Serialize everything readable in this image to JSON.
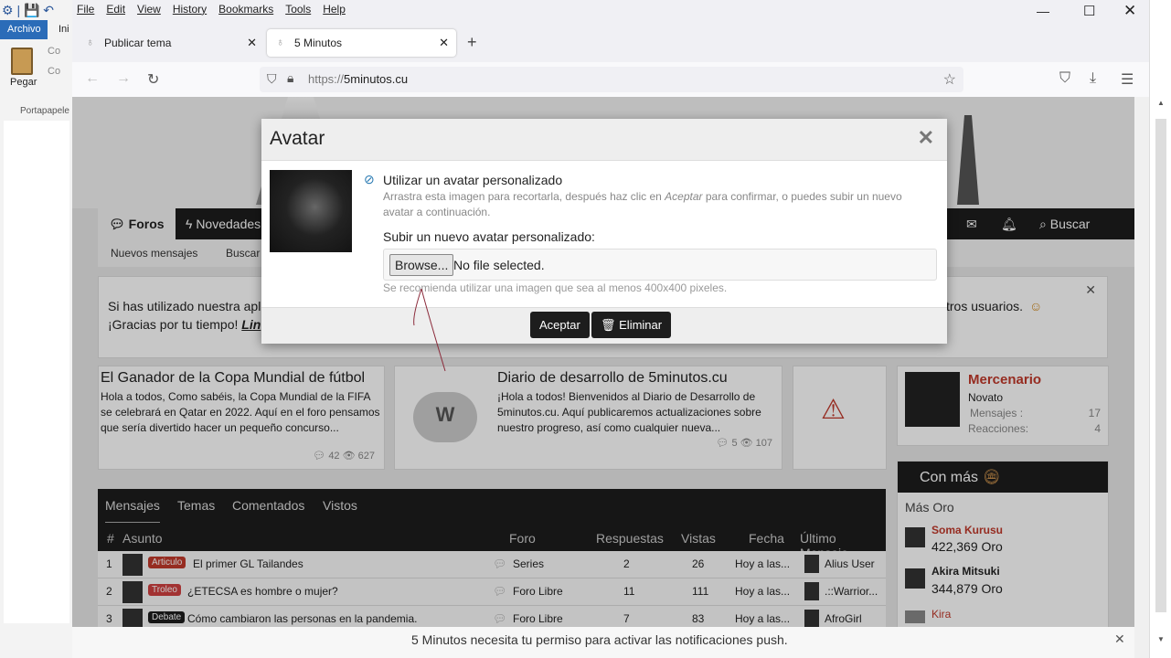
{
  "left_app": {
    "tab_file": "Archivo",
    "tab_home": "Ini",
    "paste": "Pegar",
    "clipboard_group": "Portapapele",
    "cut": "Co",
    "copy": "Co"
  },
  "browser": {
    "menu": [
      "File",
      "Edit",
      "View",
      "History",
      "Bookmarks",
      "Tools",
      "Help"
    ],
    "tabs": [
      {
        "title": "Publicar tema",
        "active": false
      },
      {
        "title": "5 Minutos",
        "active": true
      }
    ],
    "url_prefix": "https://",
    "url_host": "5minutos.cu"
  },
  "site": {
    "nav": {
      "forums": "Foros",
      "news": "Novedades",
      "search": "Buscar"
    },
    "subnav": {
      "new_posts": "Nuevos mensajes",
      "search": "Buscar"
    },
    "notice": {
      "line1_start": "Si has utilizado nuestra apli",
      "line1_end": "tros usuarios.",
      "line2": "¡Gracias por tu tiempo! ",
      "line2_link": "Lin"
    },
    "articles": [
      {
        "title": "El Ganador de la Copa Mundial de fútbol",
        "body": "Hola a todos, Como sabéis, la Copa Mundial de la FIFA se celebrará en Qatar en 2022. Aquí en el foro pensamos que sería divertido hacer un pequeño concurso...",
        "replies": "42",
        "views": "627"
      },
      {
        "title": "Diario de desarrollo de 5minutos.cu",
        "body": "¡Hola a todos! Bienvenidos al Diario de Desarrollo de 5minutos.cu. Aquí publicaremos actualizaciones sobre nuestro progreso, así como cualquier nueva...",
        "replies": "5",
        "views": "107"
      }
    ],
    "user": {
      "name": "Mercenario",
      "rank": "Novato",
      "messages_label": "Mensajes :",
      "messages": "17",
      "reactions_label": "Reacciones:",
      "reactions": "4"
    },
    "gold": {
      "title": "Con más",
      "subtitle": "Más Oro",
      "users": [
        {
          "name": "Soma Kurusu",
          "amount": "422,369 Oro"
        },
        {
          "name": "Akira Mitsuki",
          "amount": "344,879 Oro"
        },
        {
          "name": "Kira",
          "amount": ""
        }
      ]
    },
    "table": {
      "tabs": [
        "Mensajes",
        "Temas",
        "Comentados",
        "Vistos"
      ],
      "headers": {
        "num": "#",
        "subject": "Asunto",
        "forum": "Foro",
        "replies": "Respuestas",
        "views": "Vistas",
        "date": "Fecha",
        "last": "Último Mensaje"
      },
      "rows": [
        {
          "n": "1",
          "badge": "Articulo",
          "badge_color": "#c0392b",
          "subject": "El primer GL Tailandes",
          "forum": "Series",
          "replies": "2",
          "views": "26",
          "date": "Hoy a las...",
          "last": "Alius User"
        },
        {
          "n": "2",
          "badge": "Troleo",
          "badge_color": "#d04040",
          "subject": "¿ETECSA es hombre o mujer?",
          "forum": "Foro Libre",
          "replies": "11",
          "views": "111",
          "date": "Hoy a las...",
          "last": ".::Warrior..."
        },
        {
          "n": "3",
          "badge": "Debate",
          "badge_color": "#1d1d1d",
          "subject": "Cómo cambiaron las personas en la pandemia.",
          "forum": "Foro Libre",
          "replies": "7",
          "views": "83",
          "date": "Hoy a las...",
          "last": "AfroGirl"
        }
      ]
    },
    "push_notice": "5 Minutos necesita tu permiso para activar las notificaciones push."
  },
  "modal": {
    "title": "Avatar",
    "option_label": "Utilizar un avatar personalizado",
    "description_1": "Arrastra esta imagen para recortarla, después haz clic en ",
    "description_em": "Aceptar",
    "description_2": " para confirmar, o puedes subir un nuevo avatar a continuación.",
    "upload_label": "Subir un nuevo avatar personalizado:",
    "browse": "Browse...",
    "file_status": "No file selected.",
    "hint": "Se recomienda utilizar una imagen que sea al menos 400x400 pixeles.",
    "accept": "Aceptar",
    "delete": "Eliminar"
  }
}
